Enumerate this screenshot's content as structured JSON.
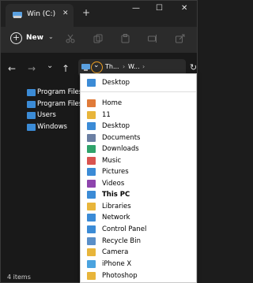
{
  "tab": {
    "title": "Win (C:)",
    "close": "✕"
  },
  "newtab": "+",
  "window_controls": {
    "minimize": "—",
    "maximize": "☐",
    "close": "✕"
  },
  "command_bar": {
    "new_label": "New",
    "new_chevron": "⌄"
  },
  "nav": {
    "back": "←",
    "forward": "→",
    "recent": "⌄",
    "up": "↑"
  },
  "address": {
    "crumb1": "Th...",
    "sep1": "›",
    "crumb2": "W...",
    "sep2": "›",
    "refresh": "↻"
  },
  "tree": [
    {
      "label": "Program Files"
    },
    {
      "label": "Program Files ("
    },
    {
      "label": "Users"
    },
    {
      "label": "Windows"
    }
  ],
  "status": {
    "items": "4 items"
  },
  "dropdown": [
    {
      "label": "Desktop",
      "icon": "desktop-icon",
      "bold": false
    },
    {
      "label": "Home",
      "icon": "home-icon",
      "bold": false
    },
    {
      "label": "11",
      "icon": "folder-icon",
      "bold": false
    },
    {
      "label": "Desktop",
      "icon": "desktop-icon",
      "bold": false
    },
    {
      "label": "Documents",
      "icon": "documents-icon",
      "bold": false
    },
    {
      "label": "Downloads",
      "icon": "downloads-icon",
      "bold": false
    },
    {
      "label": "Music",
      "icon": "music-icon",
      "bold": false
    },
    {
      "label": "Pictures",
      "icon": "pictures-icon",
      "bold": false
    },
    {
      "label": "Videos",
      "icon": "videos-icon",
      "bold": false
    },
    {
      "label": "This PC",
      "icon": "this-pc-icon",
      "bold": true
    },
    {
      "label": "Libraries",
      "icon": "libraries-icon",
      "bold": false
    },
    {
      "label": "Network",
      "icon": "network-icon",
      "bold": false
    },
    {
      "label": "Control Panel",
      "icon": "control-panel-icon",
      "bold": false
    },
    {
      "label": "Recycle Bin",
      "icon": "recycle-bin-icon",
      "bold": false
    },
    {
      "label": "Camera",
      "icon": "folder-icon",
      "bold": false
    },
    {
      "label": "iPhone X",
      "icon": "phone-icon",
      "bold": false
    },
    {
      "label": "Photoshop",
      "icon": "folder-icon",
      "bold": false
    }
  ],
  "colors": {
    "accent": "#f0a020",
    "folder": "#3b8bd6",
    "yellow_folder": "#e8b53a"
  }
}
